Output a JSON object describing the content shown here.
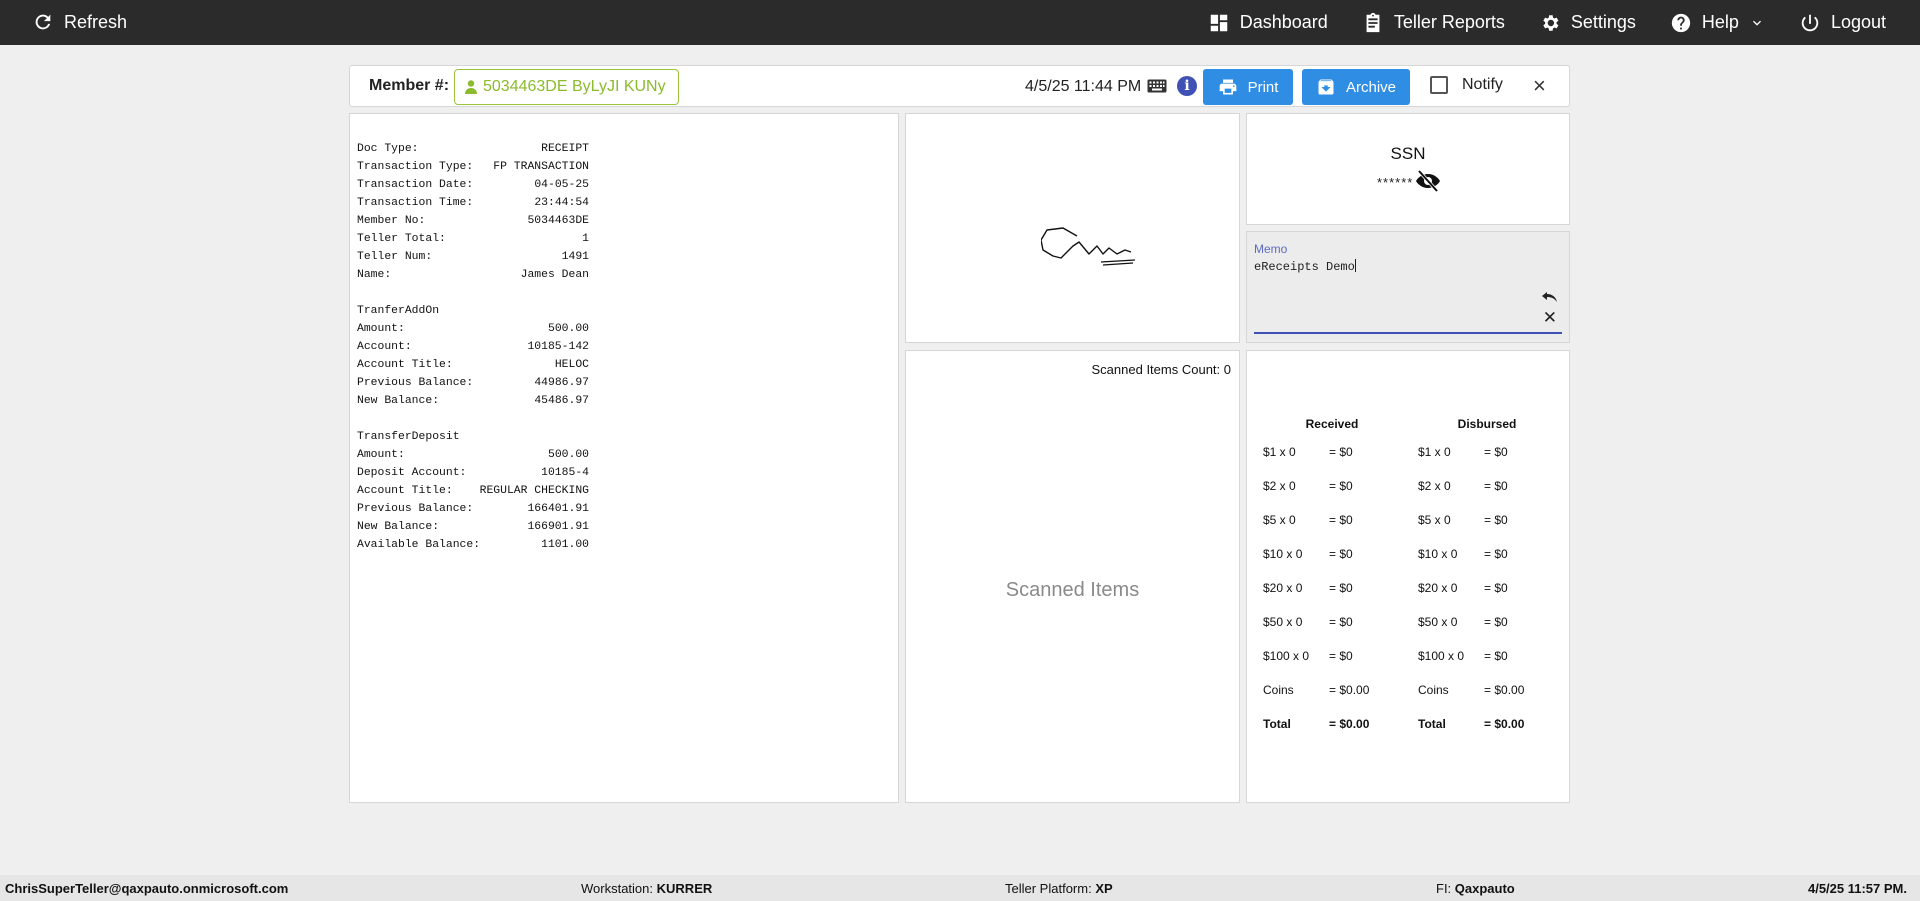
{
  "topbar": {
    "refresh": "Refresh",
    "dashboard": "Dashboard",
    "teller_reports": "Teller Reports",
    "settings": "Settings",
    "help": "Help",
    "logout": "Logout"
  },
  "header": {
    "member_label": "Member #:",
    "member_value": "5034463DE ByLyJI KUNy",
    "datetime": "4/5/25 11:44 PM",
    "print": "Print",
    "archive": "Archive",
    "notify": "Notify",
    "close": "×"
  },
  "receipt": [
    {
      "k": "Doc Type:",
      "v": "RECEIPT"
    },
    {
      "k": "Transaction Type:",
      "v": "FP TRANSACTION"
    },
    {
      "k": "Transaction Date:",
      "v": "04-05-25"
    },
    {
      "k": "Transaction Time:",
      "v": "23:44:54"
    },
    {
      "k": "Member No:",
      "v": "5034463DE"
    },
    {
      "k": "Teller Total:",
      "v": "1"
    },
    {
      "k": "Teller Num:",
      "v": "1491"
    },
    {
      "k": "Name:",
      "v": "James Dean"
    },
    {
      "gap": true
    },
    {
      "h": "TranferAddOn"
    },
    {
      "k": "Amount:",
      "v": "500.00"
    },
    {
      "k": "Account:",
      "v": "10185-142"
    },
    {
      "k": "Account Title:",
      "v": "HELOC"
    },
    {
      "k": "Previous Balance:",
      "v": "44986.97"
    },
    {
      "k": "New Balance:",
      "v": "45486.97"
    },
    {
      "gap": true
    },
    {
      "h": "TransferDeposit"
    },
    {
      "k": "Amount:",
      "v": "500.00"
    },
    {
      "k": "Deposit Account:",
      "v": "10185-4"
    },
    {
      "k": "Account Title:",
      "v": "REGULAR CHECKING"
    },
    {
      "k": "Previous Balance:",
      "v": "166401.91"
    },
    {
      "k": "New Balance:",
      "v": "166901.91"
    },
    {
      "k": "Available Balance:",
      "v": "1101.00"
    }
  ],
  "ssn": {
    "title": "SSN",
    "masked": "******"
  },
  "memo": {
    "label": "Memo",
    "value": "eReceipts Demo"
  },
  "scanned": {
    "count_text": "Scanned Items Count: 0",
    "placeholder": "Scanned Items"
  },
  "cash": {
    "received_title": "Received",
    "disbursed_title": "Disbursed",
    "received": [
      {
        "d": "$1 x 0",
        "a": "= $0"
      },
      {
        "d": "$2 x 0",
        "a": "= $0"
      },
      {
        "d": "$5 x 0",
        "a": "= $0"
      },
      {
        "d": "$10 x 0",
        "a": "= $0"
      },
      {
        "d": "$20 x 0",
        "a": "= $0"
      },
      {
        "d": "$50 x 0",
        "a": "= $0"
      },
      {
        "d": "$100 x 0",
        "a": "= $0"
      },
      {
        "d": "Coins",
        "a": "= $0.00"
      },
      {
        "d": "Total",
        "a": "= $0.00",
        "total": true
      }
    ],
    "disbursed": [
      {
        "d": "$1 x 0",
        "a": "= $0"
      },
      {
        "d": "$2 x 0",
        "a": "= $0"
      },
      {
        "d": "$5 x 0",
        "a": "= $0"
      },
      {
        "d": "$10 x 0",
        "a": "= $0"
      },
      {
        "d": "$20 x 0",
        "a": "= $0"
      },
      {
        "d": "$50 x 0",
        "a": "= $0"
      },
      {
        "d": "$100 x 0",
        "a": "= $0"
      },
      {
        "d": "Coins",
        "a": "= $0.00"
      },
      {
        "d": "Total",
        "a": "= $0.00",
        "total": true
      }
    ]
  },
  "statusbar": {
    "user": "ChrisSuperTeller@qaxpauto.onmicrosoft.com",
    "workstation_label": "Workstation:",
    "workstation": "KURRER",
    "platform_label": "Teller Platform:",
    "platform": "XP",
    "fi_label": "FI:",
    "fi": "Qaxpauto",
    "datetime": "4/5/25 11:57 PM."
  },
  "colors": {
    "topbar": "#2b2b2b",
    "button": "#2f8de4",
    "member_accent": "#8bbb2d",
    "memo_accent": "#3f51b5"
  }
}
